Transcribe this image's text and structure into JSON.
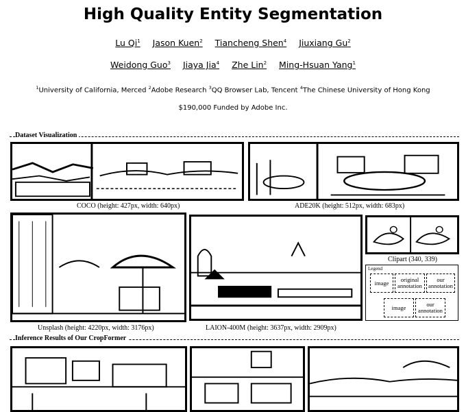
{
  "header": {
    "title": "High Quality Entity Segmentation",
    "authors_row1": [
      {
        "name": "Lu Qi",
        "sup": "1"
      },
      {
        "name": "Jason Kuen",
        "sup": "2"
      },
      {
        "name": "Tiancheng Shen",
        "sup": "4"
      },
      {
        "name": "Jiuxiang Gu",
        "sup": "2"
      }
    ],
    "authors_row2": [
      {
        "name": "Weidong Guo",
        "sup": "3"
      },
      {
        "name": "Jiaya Jia",
        "sup": "4"
      },
      {
        "name": "Zhe Lin",
        "sup": "2"
      },
      {
        "name": "Ming-Hsuan Yang",
        "sup": "1"
      }
    ],
    "affiliations": [
      {
        "sup": "1",
        "text": "University of California, Merced "
      },
      {
        "sup": "2",
        "text": "Adobe Research "
      },
      {
        "sup": "3",
        "text": "QQ Browser Lab, Tencent "
      },
      {
        "sup": "4",
        "text": "The Chinese University of Hong Kong"
      }
    ],
    "funding": "$190,000 Funded by Adobe Inc."
  },
  "dataset": {
    "label": "Dataset Visualization",
    "captions": {
      "coco": "COCO (height: 427px, width: 640px)",
      "ade": "ADE20K (height: 512px, width: 683px)",
      "unsplash": "Unsplash (height: 4220px, width: 3176px)",
      "laion": "LAION-400M (height: 3637px, width: 2909px)",
      "clipart": "Clipart (340, 339)"
    }
  },
  "legend": {
    "title": "Legend",
    "image": "image",
    "original_annotation": "original annotation",
    "our_annotation": "our annotation"
  },
  "inference": {
    "label": "Inference Results of Our CropFormer"
  }
}
